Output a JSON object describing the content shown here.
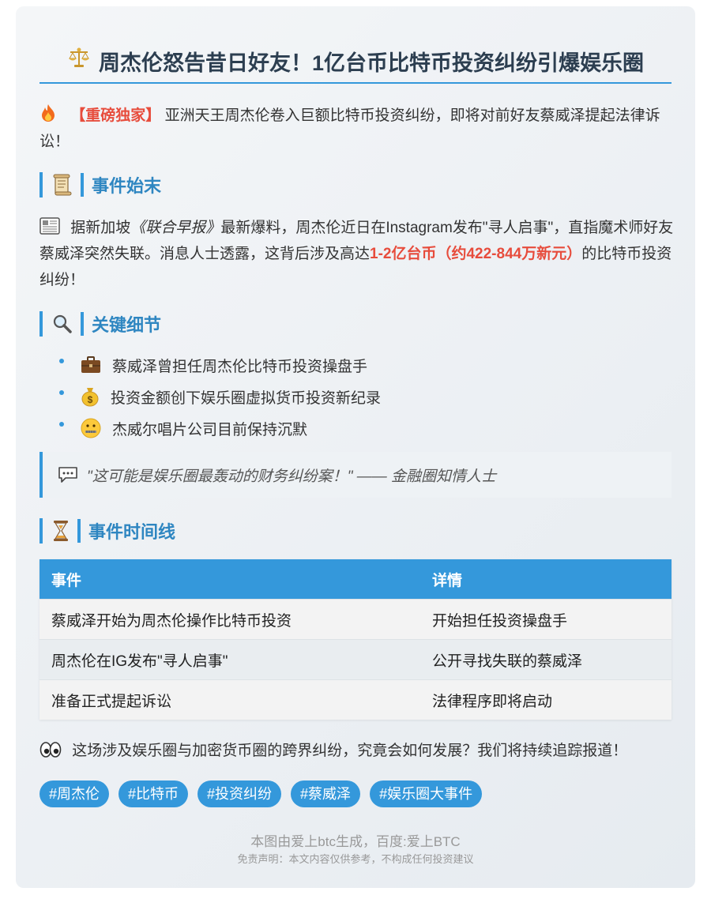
{
  "title": "周杰伦怒告昔日好友！1亿台币比特币投资纠纷引爆娱乐圈",
  "intro": {
    "tag": "【重磅独家】",
    "text": " 亚洲天王周杰伦卷入巨额比特币投资纠纷，即将对前好友蔡威泽提起法律诉讼！"
  },
  "section1": {
    "heading": "事件始末",
    "p_before": " 据新加坡",
    "p_source": "《联合早报》",
    "p_mid": "最新爆料，周杰伦近日在Instagram发布\"寻人启事\"，直指魔术师好友蔡威泽突然失联。消息人士透露，这背后涉及高达",
    "p_amount": "1-2亿台币（约422-844万新元）",
    "p_after": "的比特币投资纠纷！"
  },
  "section2": {
    "heading": "关键细节",
    "items": [
      {
        "icon": "briefcase-icon",
        "text": "蔡威泽曾担任周杰伦比特币投资操盘手"
      },
      {
        "icon": "money-bag-icon",
        "text": "投资金额创下娱乐圈虚拟货币投资新纪录"
      },
      {
        "icon": "zipper-mouth-icon",
        "text": "杰威尔唱片公司目前保持沉默"
      }
    ]
  },
  "quote": "\"这可能是娱乐圈最轰动的财务纠纷案！\" —— 金融圈知情人士",
  "section3": {
    "heading": "事件时间线",
    "headers": [
      "事件",
      "详情"
    ],
    "rows": [
      [
        "蔡威泽开始为周杰伦操作比特币投资",
        "开始担任投资操盘手"
      ],
      [
        "周杰伦在IG发布\"寻人启事\"",
        "公开寻找失联的蔡威泽"
      ],
      [
        "准备正式提起诉讼",
        "法律程序即将启动"
      ]
    ]
  },
  "closing": " 这场涉及娱乐圈与加密货币圈的跨界纠纷，究竟会如何发展？我们将持续追踪报道！",
  "tags": [
    "#周杰伦",
    "#比特币",
    "#投资纠纷",
    "#蔡威泽",
    "#娱乐圈大事件"
  ],
  "footer": {
    "line1": "本图由爱上btc生成，百度:爱上BTC",
    "line2": "免责声明：本文内容仅供参考，不构成任何投资建议"
  },
  "colors": {
    "accent": "#3498db",
    "heading": "#2e86c1",
    "highlight": "#e74c3c",
    "title": "#2c3e50"
  }
}
